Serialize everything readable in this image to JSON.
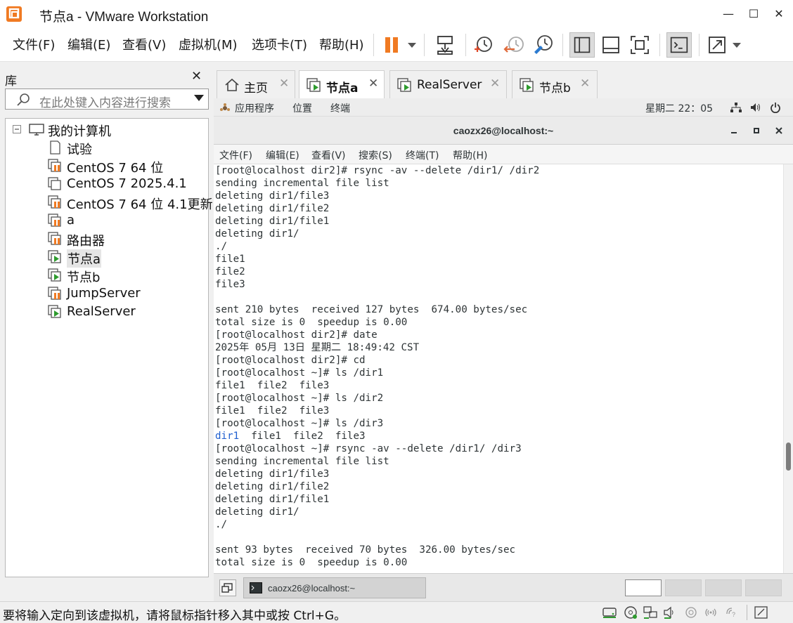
{
  "window": {
    "title": "节点a - VMware Workstation",
    "controls": {
      "minimize": "—",
      "maximize": "☐",
      "close": "✕"
    }
  },
  "menubar": {
    "items": [
      "文件(F)",
      "编辑(E)",
      "查看(V)",
      "虚拟机(M)",
      "选项卡(T)",
      "帮助(H)"
    ]
  },
  "library": {
    "title": "库",
    "close": "✕",
    "search_placeholder": "在此处键入内容进行搜索",
    "tree": {
      "root": "我的计算机",
      "items": [
        {
          "label": "试验",
          "state": "off-doc"
        },
        {
          "label": "CentOS 7 64 位",
          "state": "paused"
        },
        {
          "label": "CentOS 7 2025.4.1",
          "state": "off"
        },
        {
          "label": "CentOS 7 64 位 4.1更新",
          "state": "paused"
        },
        {
          "label": "a",
          "state": "paused"
        },
        {
          "label": "路由器",
          "state": "paused"
        },
        {
          "label": "节点a",
          "state": "running",
          "selected": true
        },
        {
          "label": "节点b",
          "state": "running"
        },
        {
          "label": "JumpServer",
          "state": "paused"
        },
        {
          "label": "RealServer",
          "state": "running"
        }
      ]
    }
  },
  "tabs": [
    {
      "label": "主页",
      "close": "✕",
      "icon": "home-icon"
    },
    {
      "label": "节点a",
      "close": "✕",
      "icon": "vm-running-icon",
      "active": true
    },
    {
      "label": "RealServer",
      "close": "✕",
      "icon": "vm-running-icon"
    },
    {
      "label": "节点b",
      "close": "✕",
      "icon": "vm-running-icon"
    }
  ],
  "guest": {
    "topbar": {
      "apps": "应用程序",
      "places": "位置",
      "terminal": "终端",
      "clock": "星期二 22：05"
    },
    "terminal_title": "caozx26@localhost:~",
    "terminal_menu": [
      "文件(F)",
      "编辑(E)",
      "查看(V)",
      "搜索(S)",
      "终端(T)",
      "帮助(H)"
    ],
    "terminal_lines": [
      "[root@localhost dir2]# rsync -av --delete /dir1/ /dir2",
      "sending incremental file list",
      "deleting dir1/file3",
      "deleting dir1/file2",
      "deleting dir1/file1",
      "deleting dir1/",
      "./",
      "file1",
      "file2",
      "file3",
      "",
      "sent 210 bytes  received 127 bytes  674.00 bytes/sec",
      "total size is 0  speedup is 0.00",
      "[root@localhost dir2]# date",
      "2025年 05月 13日 星期二 18:49:42 CST",
      "[root@localhost dir2]# cd",
      "[root@localhost ~]# ls /dir1",
      "file1  file2  file3",
      "[root@localhost ~]# ls /dir2",
      "file1  file2  file3",
      "[root@localhost ~]# ls /dir3",
      "dir1  file1  file2  file3",
      "[root@localhost ~]# rsync -av --delete /dir1/ /dir3",
      "sending incremental file list",
      "deleting dir1/file3",
      "deleting dir1/file2",
      "deleting dir1/file1",
      "deleting dir1/",
      "./",
      "",
      "sent 93 bytes  received 70 bytes  326.00 bytes/sec",
      "total size is 0  speedup is 0.00"
    ],
    "taskbar": {
      "window_label": "caozx26@localhost:~"
    }
  },
  "statusbar": {
    "text": "要将输入定向到该虚拟机，请将鼠标指针移入其中或按 Ctrl+G。"
  },
  "colors": {
    "accent": "#f07a22",
    "running": "#2e9b2e",
    "paused": "#f07a22"
  }
}
